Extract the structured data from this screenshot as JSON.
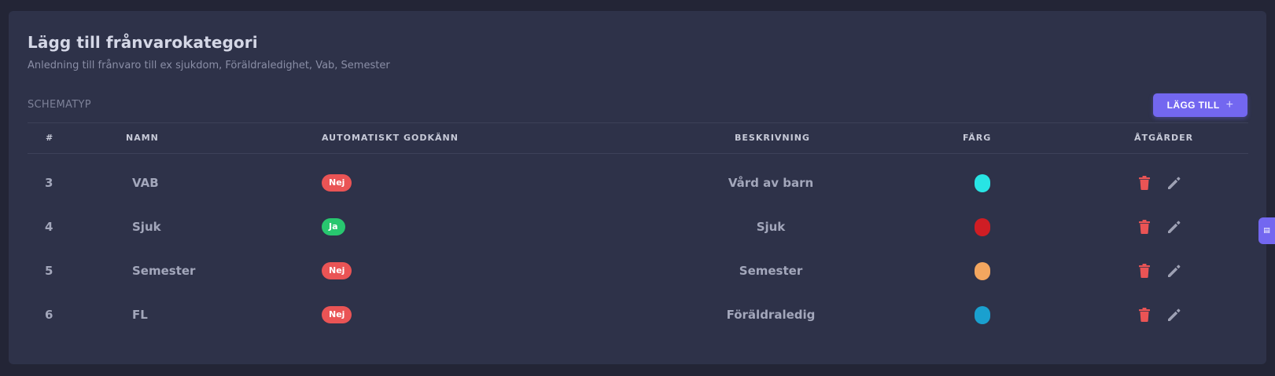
{
  "card": {
    "title": "Lägg till frånvarokategori",
    "subtitle": "Anledning till frånvaro till ex sjukdom, Föräldraledighet, Vab, Semester"
  },
  "section_label": "SCHEMATYP",
  "add_button": {
    "label": "LÄGG TILL",
    "icon": "plus-icon"
  },
  "table": {
    "headers": {
      "id": "#",
      "name": "NAMN",
      "auto": "AUTOMATISKT GODKÄNN",
      "desc": "BESKRIVNING",
      "color": "FÄRG",
      "actions": "ÅTGÄRDER"
    },
    "rows": [
      {
        "id": "3",
        "name": "VAB",
        "auto": "Nej",
        "auto_yes": false,
        "desc": "Vård av barn",
        "color": "#28e4e4"
      },
      {
        "id": "4",
        "name": "Sjuk",
        "auto": "Ja",
        "auto_yes": true,
        "desc": "Sjuk",
        "color": "#cf1d24"
      },
      {
        "id": "5",
        "name": "Semester",
        "auto": "Nej",
        "auto_yes": false,
        "desc": "Semester",
        "color": "#f3a65f"
      },
      {
        "id": "6",
        "name": "FL",
        "auto": "Nej",
        "auto_yes": false,
        "desc": "Föräldraledig",
        "color": "#1aa0cf"
      }
    ],
    "row_actions": [
      "trash-icon",
      "pencil-icon"
    ]
  },
  "colors": {
    "accent": "#7367f0",
    "danger": "#ea5455",
    "success": "#28c76f",
    "background": "#232536",
    "card": "#2e3249"
  },
  "side_tab": {
    "icon": "settings-tab-icon"
  }
}
